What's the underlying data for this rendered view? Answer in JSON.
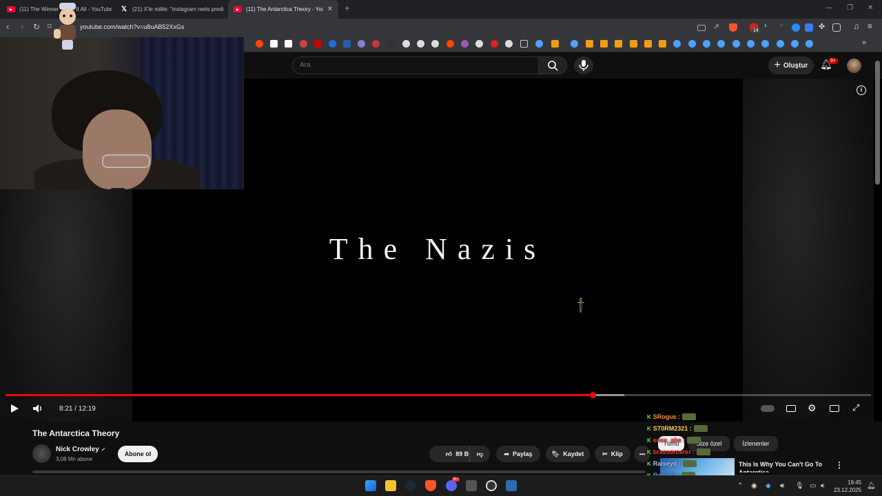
{
  "browser": {
    "tabs": [
      {
        "title": "(11) The Winner Takes It All - YouTube",
        "icon": "youtube-icon",
        "active": false
      },
      {
        "title": "(21) X'te millie: \"instagram reels predi",
        "icon": "x-icon",
        "active": false
      },
      {
        "title": "(11) The Antarctica Theory - YouTube",
        "icon": "youtube-icon",
        "active": true
      }
    ],
    "new_tab": "+",
    "url": "youtube.com/watch?v=u8uAB52XxGs",
    "ext_badge": "14"
  },
  "youtube": {
    "search_placeholder": "Ara",
    "create_label": "Oluştur",
    "notification_count": "9+",
    "info_icon": "i"
  },
  "video": {
    "frame_text": "The Nazis",
    "current_time": "8:21",
    "duration": "12:19",
    "time_display": "8:21 / 12:19",
    "progress": 0.678,
    "buffered": 0.715,
    "title": "The Antarctica Theory",
    "channel": "Nick Crowley",
    "subscribers": "3,08 Mn abone",
    "subscribe_label": "Abone ol",
    "likes": "89 B",
    "share_label": "Paylaş",
    "save_label": "Kaydet",
    "clip_label": "Klip",
    "more": "•••"
  },
  "chat": [
    {
      "user": "SRogue :",
      "color": "#ff8a3d"
    },
    {
      "user": "ST0RM2321 :",
      "color": "#ffd54a"
    },
    {
      "user": "enes_abe :",
      "color": "#ff3b3b"
    },
    {
      "user": "brassorcerer :",
      "color": "#ff3b3b"
    },
    {
      "user": "Ralseyd :",
      "color": "#b0c8ff"
    },
    {
      "user": "Rabonk :",
      "color": "#5aa0ff"
    },
    {
      "user": "Atmetheus :",
      "color": "#5aa0ff"
    }
  ],
  "related": {
    "chips": [
      "Tümü",
      "Size özel",
      "İzlenenler"
    ],
    "title": "This Is Why You Can't Go To Antarctica",
    "more": "⋮"
  },
  "taskbar": {
    "time": "19:45",
    "date": "23.12.2025",
    "discord_badge": "9+"
  }
}
